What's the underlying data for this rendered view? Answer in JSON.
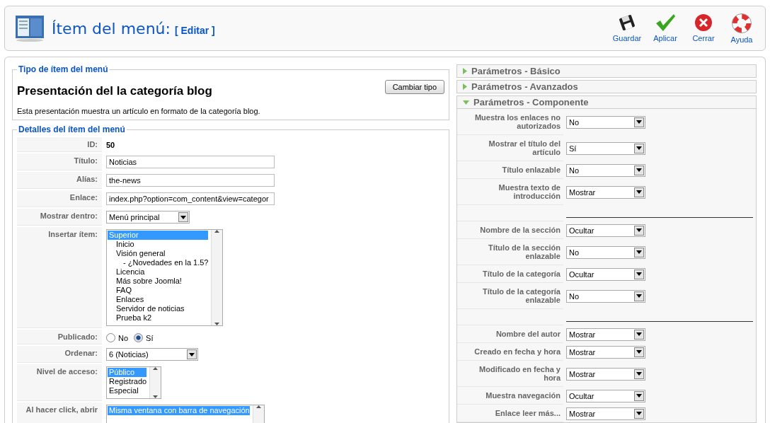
{
  "header": {
    "title": "Ítem del menú:",
    "subtitle": "[ Editar ]"
  },
  "toolbar": [
    {
      "kind": "save",
      "label": "Guardar"
    },
    {
      "kind": "apply",
      "label": "Aplicar"
    },
    {
      "kind": "close",
      "label": "Cerrar"
    },
    {
      "kind": "help",
      "label": "Ayuda"
    }
  ],
  "menu_type": {
    "legend": "Tipo de ítem del menú",
    "button": "Cambiar tipo",
    "title": "Presentación del la categoría blog",
    "description": "Esta presentación muestra un artículo en formato de la categoría blog."
  },
  "details": {
    "legend": "Detalles del ítem del menú",
    "rows": [
      {
        "kind": "text",
        "label": "ID:",
        "value": "50"
      },
      {
        "kind": "input",
        "label": "Título:",
        "value": "Noticias"
      },
      {
        "kind": "input",
        "label": "Alías:",
        "value": "the-news"
      },
      {
        "kind": "input",
        "label": "Enlace:",
        "value": "index.php?option=com_content&view=categor"
      },
      {
        "kind": "select",
        "label": "Mostrar dentro:",
        "value": "Menú principal"
      },
      {
        "kind": "listbox",
        "label": "Insertar ítem:",
        "options": [
          {
            "label": "Superior",
            "selected": true,
            "children": [
              {
                "label": "Inicio",
                "selected": false
              },
              {
                "label": "Visión general",
                "selected": false,
                "children": [
                  {
                    "label": "- ¿Novedades en la 1.5?",
                    "selected": false
                  }
                ]
              },
              {
                "label": "Licencia",
                "selected": false
              },
              {
                "label": "Más sobre Joomla!",
                "selected": false
              },
              {
                "label": "FAQ",
                "selected": false
              },
              {
                "label": "Enlaces",
                "selected": false
              },
              {
                "label": "Servidor de noticias",
                "selected": false
              },
              {
                "label": "Prueba k2",
                "selected": false
              }
            ]
          }
        ]
      },
      {
        "kind": "radio",
        "label": "Publicado:",
        "options": [
          {
            "label": "No",
            "selected": false
          },
          {
            "label": "Sí",
            "selected": true
          }
        ]
      },
      {
        "kind": "select",
        "label": "Ordenar:",
        "value": "6 (Noticias)"
      },
      {
        "kind": "listbox",
        "label": "Nivel de acceso:",
        "options": [
          {
            "label": "Público",
            "selected": true
          },
          {
            "label": "Registrado",
            "selected": false
          },
          {
            "label": "Especial",
            "selected": false
          }
        ]
      },
      {
        "kind": "listbox",
        "label": "Al hacer click, abrir",
        "options": [
          {
            "label": "Misma ventana con barra de navegación",
            "selected": true
          }
        ]
      }
    ]
  },
  "panels": [
    {
      "title": "Parámetros - Básico",
      "expanded": false
    },
    {
      "title": "Parámetros - Avanzados",
      "expanded": false
    },
    {
      "title": "Parámetros - Componente",
      "expanded": true,
      "params": [
        {
          "kind": "select",
          "label": "Muestra los enlaces no autorizados",
          "value": "No"
        },
        {
          "kind": "select",
          "label": "Mostrar el título del artículo",
          "value": "Sí"
        },
        {
          "kind": "select",
          "label": "Título enlazable",
          "value": "No"
        },
        {
          "kind": "select",
          "label": "Muestra texto de introducción",
          "value": "Mostrar"
        },
        {
          "kind": "spacer"
        },
        {
          "kind": "select",
          "label": "Nombre de la sección",
          "value": "Ocultar"
        },
        {
          "kind": "select",
          "label": "Título de la sección enlazable",
          "value": "No"
        },
        {
          "kind": "select",
          "label": "Título de la categoría",
          "value": "Ocultar"
        },
        {
          "kind": "select",
          "label": "Título de la categoría enlazable",
          "value": "No"
        },
        {
          "kind": "spacer"
        },
        {
          "kind": "select",
          "label": "Nombre del autor",
          "value": "Mostrar"
        },
        {
          "kind": "select",
          "label": "Creado en fecha y hora",
          "value": "Mostrar"
        },
        {
          "kind": "select",
          "label": "Modificado en fecha y hora",
          "value": "Mostrar"
        },
        {
          "kind": "select",
          "label": "Muestra navegación",
          "value": "Ocultar"
        },
        {
          "kind": "select",
          "label": "Enlace leer más...",
          "value": "Mostrar"
        }
      ]
    }
  ]
}
